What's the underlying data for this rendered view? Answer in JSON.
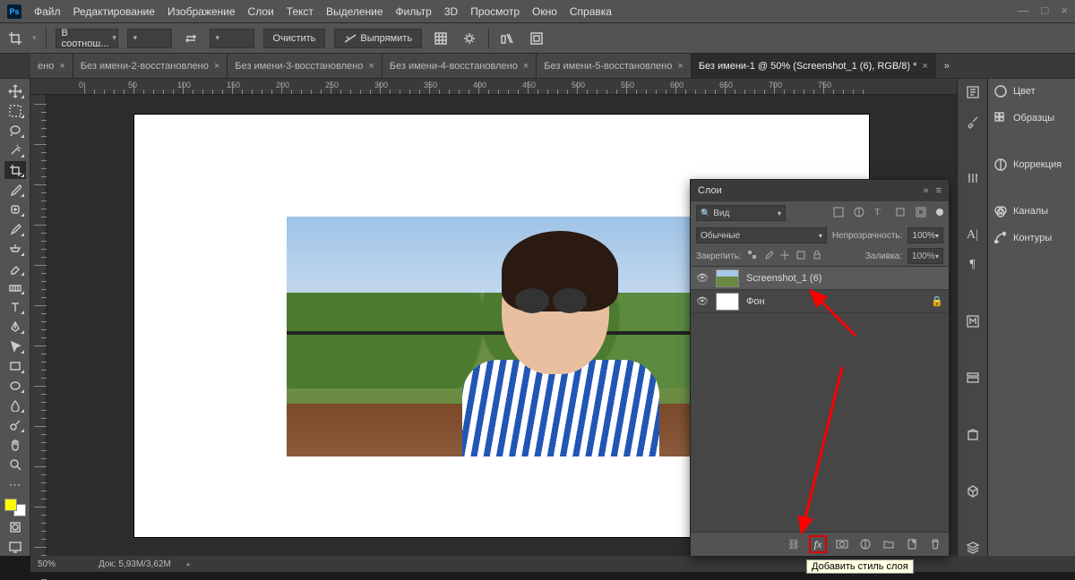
{
  "menu": {
    "items": [
      "Файл",
      "Редактирование",
      "Изображение",
      "Слои",
      "Текст",
      "Выделение",
      "Фильтр",
      "3D",
      "Просмотр",
      "Окно",
      "Справка"
    ]
  },
  "options": {
    "ratio_label": "В соотнош...",
    "clear": "Очистить",
    "straighten": "Выпрямить"
  },
  "tabs": [
    {
      "label": "ено",
      "close": "×",
      "active": false
    },
    {
      "label": "Без имени-2-восстановлено",
      "close": "×",
      "active": false
    },
    {
      "label": "Без имени-3-восстановлено",
      "close": "×",
      "active": false
    },
    {
      "label": "Без имени-4-восстановлено",
      "close": "×",
      "active": false
    },
    {
      "label": "Без имени-5-восстановлено",
      "close": "×",
      "active": false
    },
    {
      "label": "Без имени-1 @ 50% (Screenshot_1 (6), RGB/8) *",
      "close": "×",
      "active": true
    }
  ],
  "rightPanels": [
    {
      "icon": "color",
      "label": "Цвет"
    },
    {
      "icon": "swatches",
      "label": "Образцы"
    },
    {
      "icon": "adjust",
      "label": "Коррекция"
    },
    {
      "icon": "channels",
      "label": "Каналы"
    },
    {
      "icon": "paths",
      "label": "Контуры"
    }
  ],
  "layersPanel": {
    "title": "Слои",
    "filterKind": "Вид",
    "blendMode": "Обычные",
    "opacityLabel": "Непрозрачность:",
    "opacityValue": "100%",
    "lockLabel": "Закрепить:",
    "fillLabel": "Заливка:",
    "fillValue": "100%",
    "layers": [
      {
        "name": "Screenshot_1 (6)",
        "selected": true,
        "locked": false,
        "thumb": "photo"
      },
      {
        "name": "Фон",
        "selected": false,
        "locked": true,
        "thumb": "white"
      }
    ],
    "tooltip": "Добавить стиль слоя"
  },
  "status": {
    "zoom": "50%",
    "docsize": "Док: 5,93M/3,62M"
  },
  "swatches": {
    "fg": "#fffb00",
    "bg": "#ffffff"
  },
  "ruler": {
    "marks": [
      "0",
      "50",
      "100",
      "150",
      "200",
      "250",
      "300",
      "350",
      "400",
      "450",
      "500",
      "550",
      "600",
      "650",
      "700",
      "750"
    ]
  }
}
